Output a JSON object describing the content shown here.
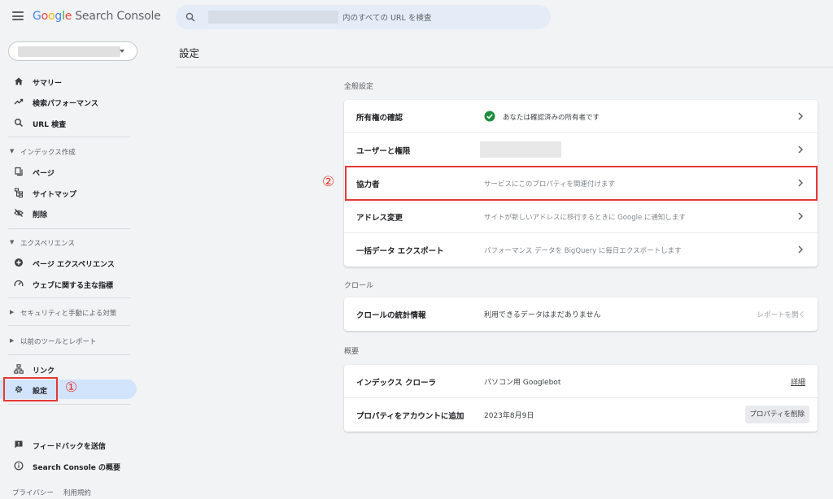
{
  "header": {
    "logo_letters": [
      "G",
      "o",
      "o",
      "g",
      "l",
      "e"
    ],
    "product_name": "Search Console",
    "search_placeholder": "内のすべての URL を検査"
  },
  "sidebar": {
    "items": [
      {
        "label": "サマリー",
        "icon": "home-icon"
      },
      {
        "label": "検索パフォーマンス",
        "icon": "trending-up-icon"
      },
      {
        "label": "URL 検査",
        "icon": "search-icon"
      }
    ],
    "sections": {
      "index": {
        "label": "インデックス作成",
        "items": [
          {
            "label": "ページ",
            "icon": "pages-icon"
          },
          {
            "label": "サイトマップ",
            "icon": "sitemap-icon"
          },
          {
            "label": "削除",
            "icon": "visibility-off-icon"
          }
        ]
      },
      "experience": {
        "label": "エクスペリエンス",
        "items": [
          {
            "label": "ページ エクスペリエンス",
            "icon": "add-circle-icon"
          },
          {
            "label": "ウェブに関する主な指標",
            "icon": "speed-icon"
          }
        ]
      },
      "security": {
        "label": "セキュリティと手動による対策"
      },
      "legacy": {
        "label": "以前のツールとレポート"
      }
    },
    "bottom_items": [
      {
        "label": "リンク",
        "icon": "links-icon"
      },
      {
        "label": "設定",
        "icon": "gear-icon"
      }
    ],
    "footer_items": [
      {
        "label": "フィードバックを送信",
        "icon": "feedback-icon"
      },
      {
        "label": "Search Console の概要",
        "icon": "info-icon"
      }
    ],
    "footer_links": [
      "プライバシー",
      "利用規約"
    ]
  },
  "annotations": {
    "marker1": "①",
    "marker2": "②",
    "color": "#e53935"
  },
  "main": {
    "title": "設定",
    "general": {
      "label": "全般設定",
      "rows": [
        {
          "title": "所有権の確認",
          "desc": "あなたは確認済みの所有者です"
        },
        {
          "title": "ユーザーと権限",
          "desc": ""
        },
        {
          "title": "協力者",
          "desc": "サービスにこのプロパティを関連付けます"
        },
        {
          "title": "アドレス変更",
          "desc": "サイトが新しいアドレスに移行するときに Google に通知します"
        },
        {
          "title": "一括データ エクスポート",
          "desc": "パフォーマンス データを BigQuery に毎日エクスポートします"
        }
      ]
    },
    "crawl": {
      "label": "クロール",
      "rows": [
        {
          "title": "クロールの統計情報",
          "desc": "利用できるデータはまだありません",
          "action": "レポートを開く"
        }
      ]
    },
    "overview": {
      "label": "概要",
      "rows": [
        {
          "title": "インデックス クローラ",
          "desc": "パソコン用 Googlebot",
          "action": "詳細"
        },
        {
          "title": "プロパティをアカウントに追加",
          "desc": "2023年8月9日",
          "action": "プロパティを削除"
        }
      ]
    }
  },
  "colors": {
    "brand_blue": "#4285f4",
    "active_bg": "#d2e3fc",
    "check_green": "#1e8e3e"
  }
}
